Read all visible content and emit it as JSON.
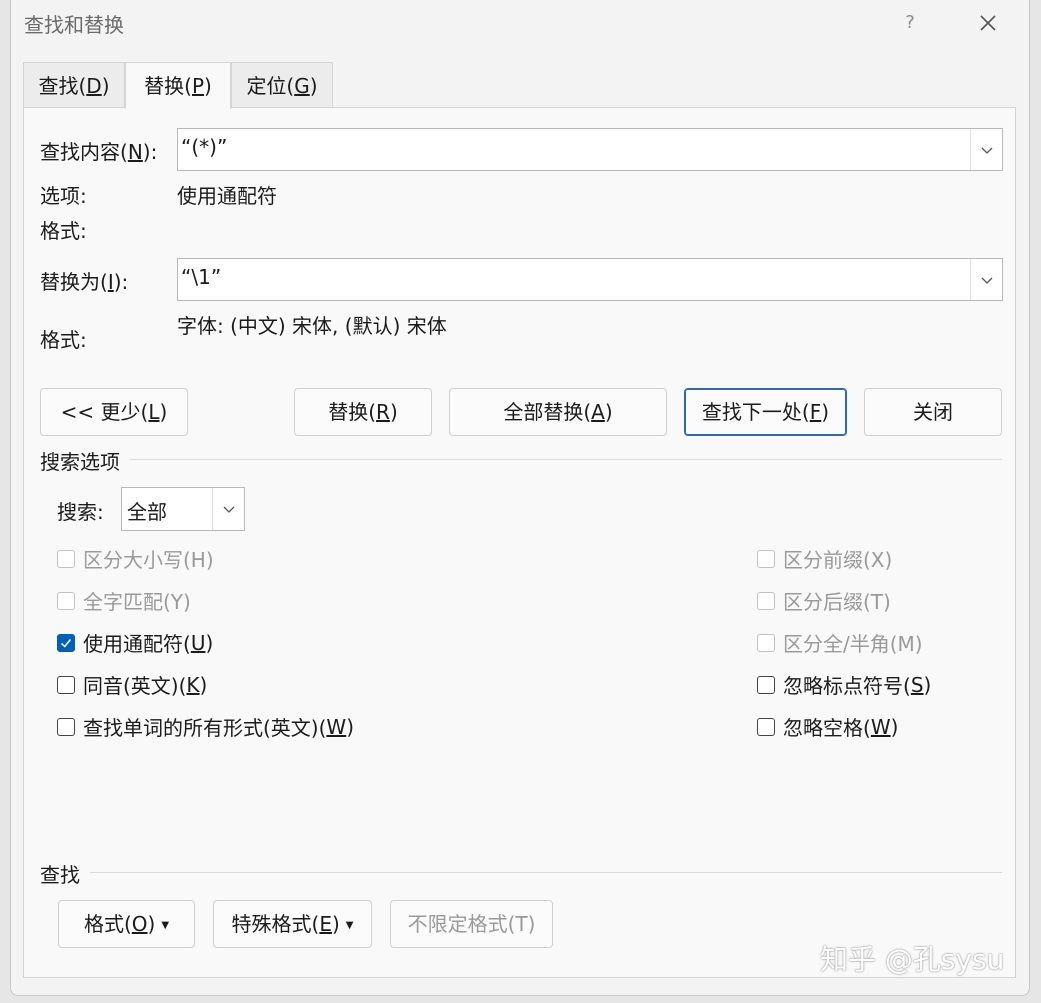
{
  "window": {
    "title": "查找和替换",
    "help_label": "?"
  },
  "tabs": [
    {
      "label": "查找(",
      "key": "D",
      "tail": ")"
    },
    {
      "label": "替换(",
      "key": "P",
      "tail": ")"
    },
    {
      "label": "定位(",
      "key": "G",
      "tail": ")"
    }
  ],
  "find": {
    "label": "查找内容(",
    "key": "N",
    "tail": "):",
    "value": "“(*)”",
    "options_label": "选项:",
    "options_value": "使用通配符",
    "format_label": "格式:",
    "format_value": ""
  },
  "replace": {
    "label": "替换为(",
    "key": "I",
    "tail": "):",
    "value": "“\\1”",
    "format_label": "格式:",
    "format_value": "字体: (中文) 宋体, (默认) 宋体"
  },
  "buttons": {
    "less": {
      "label": "<< 更少(",
      "key": "L",
      "tail": ")"
    },
    "replace": {
      "label": "替换(",
      "key": "R",
      "tail": ")"
    },
    "replace_all": {
      "label": "全部替换(",
      "key": "A",
      "tail": ")"
    },
    "find_next": {
      "label": "查找下一处(",
      "key": "F",
      "tail": ")"
    },
    "close": {
      "label": "关闭"
    }
  },
  "search_options": {
    "title": "搜索选项",
    "search_label": "搜索:",
    "search_value": "全部",
    "left": [
      {
        "label": "区分大小写(H)",
        "checked": false,
        "disabled": true
      },
      {
        "label": "全字匹配(Y)",
        "checked": false,
        "disabled": true
      },
      {
        "label": "使用通配符(",
        "key": "U",
        "tail": ")",
        "checked": true,
        "disabled": false
      },
      {
        "label": "同音(英文)(",
        "key": "K",
        "tail": ")",
        "checked": false,
        "disabled": false
      },
      {
        "label": "查找单词的所有形式(英文)(",
        "key": "W",
        "tail": ")",
        "checked": false,
        "disabled": false
      }
    ],
    "right": [
      {
        "label": "区分前缀(X)",
        "checked": false,
        "disabled": true
      },
      {
        "label": "区分后缀(T)",
        "checked": false,
        "disabled": true
      },
      {
        "label": "区分全/半角(M)",
        "checked": false,
        "disabled": true
      },
      {
        "label": "忽略标点符号(",
        "key": "S",
        "tail": ")",
        "checked": false,
        "disabled": false
      },
      {
        "label": "忽略空格(",
        "key": "W",
        "tail": ")",
        "checked": false,
        "disabled": false
      }
    ]
  },
  "find_section": {
    "title": "查找",
    "format": {
      "label": "格式(",
      "key": "O",
      "tail": ")"
    },
    "special": {
      "label": "特殊格式(",
      "key": "E",
      "tail": ")"
    },
    "no_format": {
      "label": "不限定格式(T)"
    }
  },
  "watermark": "知乎 @孔sysu"
}
